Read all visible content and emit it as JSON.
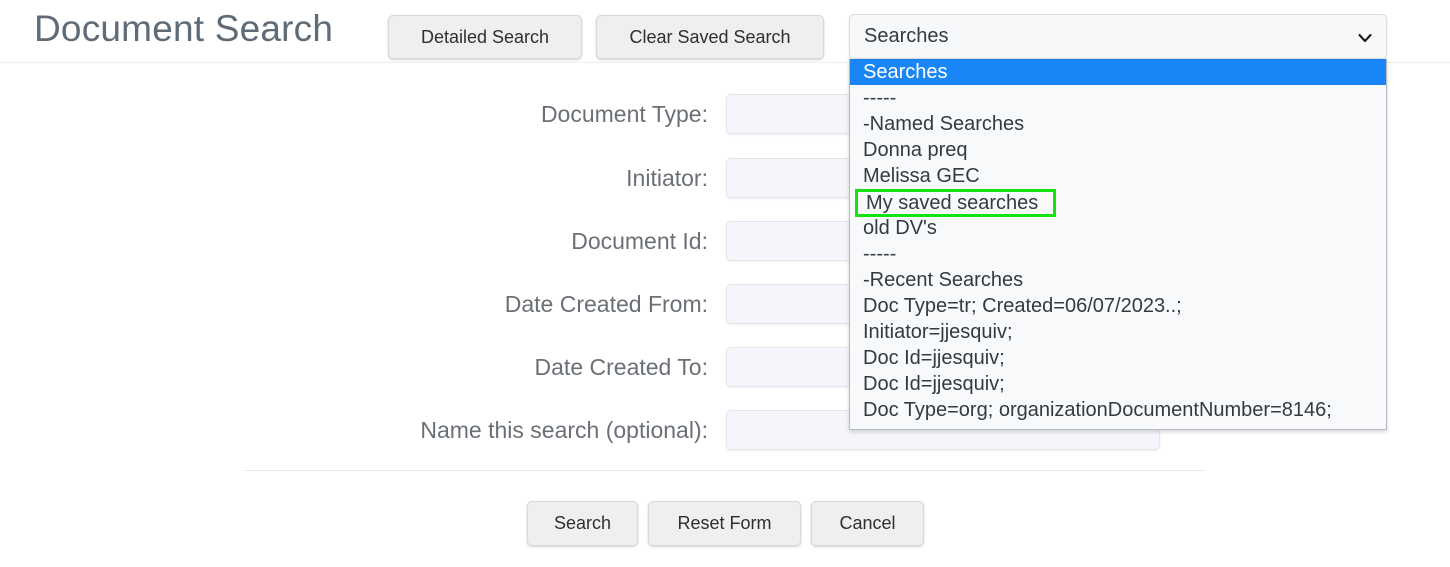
{
  "header": {
    "title": "Document Search",
    "detailed_search_label": "Detailed Search",
    "clear_saved_search_label": "Clear Saved Search"
  },
  "saved_search_select": {
    "name": "searches-select",
    "selected_value": "Searches",
    "expanded": true,
    "chevron_icon": "chevron-down-icon",
    "highlight_color": "#1a85f5",
    "annotation_color": "#14e214",
    "annotated_option": "My saved searches",
    "options": [
      {
        "label": "Searches",
        "selected": true,
        "type": "item"
      },
      {
        "label": "-----",
        "selected": false,
        "type": "separator"
      },
      {
        "label": "-Named Searches",
        "selected": false,
        "type": "group-header"
      },
      {
        "label": "Donna preq",
        "selected": false,
        "type": "item"
      },
      {
        "label": "Melissa GEC",
        "selected": false,
        "type": "item"
      },
      {
        "label": "My saved searches",
        "selected": false,
        "type": "item",
        "annotated": true
      },
      {
        "label": "old DV's",
        "selected": false,
        "type": "item"
      },
      {
        "label": "-----",
        "selected": false,
        "type": "separator"
      },
      {
        "label": "-Recent Searches",
        "selected": false,
        "type": "group-header"
      },
      {
        "label": "Doc Type=tr; Created=06/07/2023..;",
        "selected": false,
        "type": "item"
      },
      {
        "label": "Initiator=jjesquiv;",
        "selected": false,
        "type": "item"
      },
      {
        "label": "Doc Id=jjesquiv;",
        "selected": false,
        "type": "item"
      },
      {
        "label": "Doc Id=jjesquiv;",
        "selected": false,
        "type": "item"
      },
      {
        "label": "Doc Type=org; organizationDocumentNumber=8146;",
        "selected": false,
        "type": "item"
      }
    ]
  },
  "form": {
    "fields": [
      {
        "label": "Document Type:",
        "value": "",
        "placeholder": ""
      },
      {
        "label": "Initiator:",
        "value": "",
        "placeholder": ""
      },
      {
        "label": "Document Id:",
        "value": "",
        "placeholder": ""
      },
      {
        "label": "Date Created From:",
        "value": "",
        "placeholder": ""
      },
      {
        "label": "Date Created To:",
        "value": "",
        "placeholder": ""
      },
      {
        "label": "Name this search (optional):",
        "value": "",
        "placeholder": ""
      }
    ]
  },
  "footer": {
    "search_label": "Search",
    "reset_label": "Reset Form",
    "cancel_label": "Cancel"
  }
}
